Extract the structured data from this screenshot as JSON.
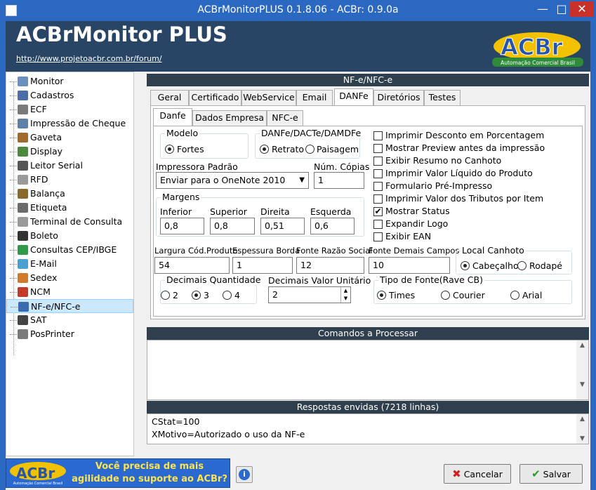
{
  "window": {
    "title": "ACBrMonitorPLUS 0.1.8.06 - ACBr: 0.9.0a"
  },
  "header": {
    "title": "ACBrMonitor PLUS",
    "url": "http://www.projetoacbr.com.br/forum/",
    "logo_text": "ACBr",
    "logo_sub": "Automação Comercial Brasil"
  },
  "sidebar": {
    "items": [
      {
        "label": "Monitor",
        "icon": "monitor-icon",
        "color": "#6b8fbf"
      },
      {
        "label": "Cadastros",
        "icon": "cadastros-icon",
        "color": "#4a6ea5"
      },
      {
        "label": "ECF",
        "icon": "printer-icon",
        "color": "#7a7a7a"
      },
      {
        "label": "Impressão de Cheque",
        "icon": "cheque-printer-icon",
        "color": "#5f7fa8"
      },
      {
        "label": "Gaveta",
        "icon": "drawer-icon",
        "color": "#a06a2c"
      },
      {
        "label": "Display",
        "icon": "display-icon",
        "color": "#4a8a3a"
      },
      {
        "label": "Leitor Serial",
        "icon": "barcode-reader-icon",
        "color": "#555555"
      },
      {
        "label": "RFD",
        "icon": "disk-icon",
        "color": "#9a9a9a"
      },
      {
        "label": "Balança",
        "icon": "scale-icon",
        "color": "#8a6a2a"
      },
      {
        "label": "Etiqueta",
        "icon": "label-printer-icon",
        "color": "#6a6a6a"
      },
      {
        "label": "Terminal de Consulta",
        "icon": "terminal-icon",
        "color": "#9a9a9a"
      },
      {
        "label": "Boleto",
        "icon": "barcode-icon",
        "color": "#333333"
      },
      {
        "label": "Consultas CEP/IBGE",
        "icon": "globe-icon",
        "color": "#2e9a4a"
      },
      {
        "label": "E-Mail",
        "icon": "email-icon",
        "color": "#4aa0d0"
      },
      {
        "label": "Sedex",
        "icon": "sedex-icon",
        "color": "#d07a2a"
      },
      {
        "label": "NCM",
        "icon": "ncm-icon",
        "color": "#c43a2a"
      },
      {
        "label": "NF-e/NFC-e",
        "icon": "nfe-icon",
        "color": "#3a6ab0"
      },
      {
        "label": "SAT",
        "icon": "sat-icon",
        "color": "#444444"
      },
      {
        "label": "PosPrinter",
        "icon": "pos-printer-icon",
        "color": "#7a7a7a"
      }
    ],
    "selected": "NF-e/NFC-e"
  },
  "panel": {
    "title": "NF-e/NFC-e"
  },
  "tabs": [
    "Geral",
    "Certificado",
    "WebService",
    "Email",
    "DANFe",
    "Diretórios",
    "Testes"
  ],
  "active_tab": "DANFe",
  "subtabs": [
    "Danfe",
    "Dados Empresa",
    "NFC-e"
  ],
  "active_subtab": "Danfe",
  "danfe": {
    "modelo_label": "Modelo",
    "modelo_opt": "Fortes",
    "orient_label": "DANFe/DACTe/DAMDFe",
    "orient_opt1": "Retrato",
    "orient_opt2": "Paisagem",
    "orient_selected": "Retrato",
    "impressora_label": "Impressora Padrão",
    "impressora_value": "Enviar para o OneNote 2010",
    "copias_label": "Núm. Cópias",
    "copias_value": "1",
    "margens_label": "Margens",
    "inferior_label": "Inferior",
    "inferior_value": "0,8",
    "superior_label": "Superior",
    "superior_value": "0,8",
    "direita_label": "Direita",
    "direita_value": "0,51",
    "esquerda_label": "Esquerda",
    "esquerda_value": "0,6",
    "largura_label": "Largura Cód.Produto",
    "largura_value": "54",
    "espessura_label": "Espessura Borda",
    "espessura_value": "1",
    "fonte_razao_label": "Fonte Razão Social",
    "fonte_razao_value": "12",
    "fonte_demais_label": "Fonte Demais Campos",
    "fonte_demais_value": "10",
    "canhoto_label": "Local Canhoto",
    "canhoto_opt1": "Cabeçalho",
    "canhoto_opt2": "Rodapé",
    "canhoto_selected": "Cabeçalho",
    "dec_qtd_label": "Decimais Quantidade",
    "dec_qtd_opts": [
      "2",
      "3",
      "4"
    ],
    "dec_qtd_selected": "3",
    "dec_val_label": "Decimais Valor Unitário",
    "dec_val_value": "2",
    "tipo_fonte_label": "Tipo de Fonte(Rave CB)",
    "tipo_fonte_opts": [
      "Times",
      "Courier",
      "Arial"
    ],
    "tipo_fonte_selected": "Times",
    "checks": [
      {
        "label": "Imprimir Desconto em Porcentagem",
        "checked": false
      },
      {
        "label": "Mostrar Preview antes da impressão",
        "checked": false
      },
      {
        "label": "Exibir Resumo no Canhoto",
        "checked": false
      },
      {
        "label": "Imprimir Valor Líquido do Produto",
        "checked": false
      },
      {
        "label": "Formulario Pré-Impresso",
        "checked": false
      },
      {
        "label": "Imprimir Valor dos Tributos por Item",
        "checked": false
      },
      {
        "label": "Mostrar Status",
        "checked": true
      },
      {
        "label": "Expandir Logo",
        "checked": false
      },
      {
        "label": "Exibir EAN",
        "checked": false
      }
    ]
  },
  "comandos": {
    "title": "Comandos a Processar"
  },
  "respostas": {
    "title": "Respostas envidas (7218 linhas)",
    "lines": [
      "CStat=100",
      "XMotivo=Autorizado o uso da NF-e"
    ]
  },
  "banner": {
    "logo": "ACBr",
    "logo_sub": "Automação Comercial Brasil",
    "line1": "Você precisa de mais",
    "line2": "agilidade no suporte ao ACBr?"
  },
  "buttons": {
    "cancel": "Cancelar",
    "save": "Salvar"
  }
}
